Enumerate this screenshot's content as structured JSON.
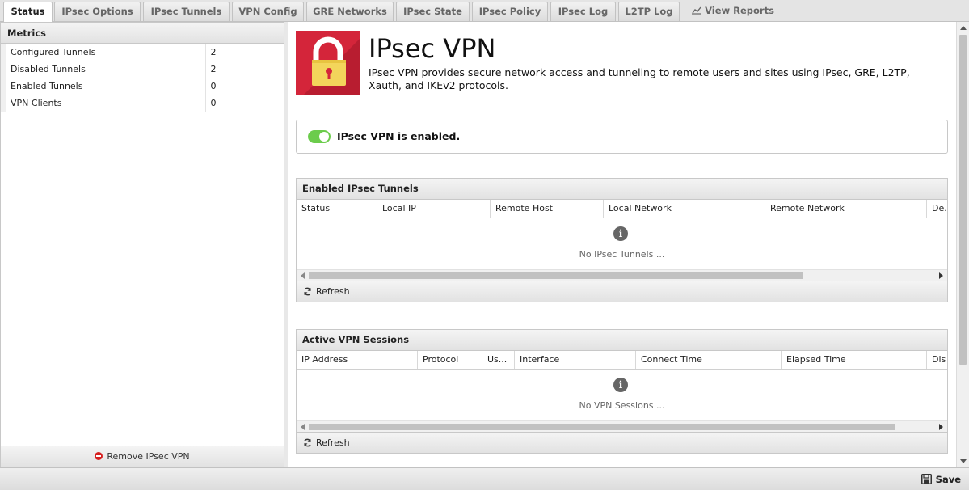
{
  "tabs": [
    {
      "label": "Status",
      "active": true
    },
    {
      "label": "IPsec Options"
    },
    {
      "label": "IPsec Tunnels"
    },
    {
      "label": "VPN Config"
    },
    {
      "label": "GRE Networks"
    },
    {
      "label": "IPsec State"
    },
    {
      "label": "IPsec Policy"
    },
    {
      "label": "IPsec Log"
    },
    {
      "label": "L2TP Log"
    },
    {
      "label": "View Reports",
      "icon": "chart-icon"
    }
  ],
  "metrics": {
    "title": "Metrics",
    "rows": [
      {
        "name": "Configured Tunnels",
        "value": "2"
      },
      {
        "name": "Disabled Tunnels",
        "value": "2"
      },
      {
        "name": "Enabled Tunnels",
        "value": "0"
      },
      {
        "name": "VPN Clients",
        "value": "0"
      }
    ],
    "remove_label": "Remove IPsec VPN"
  },
  "app": {
    "title": "IPsec VPN",
    "description": "IPsec VPN provides secure network access and tunneling to remote users and sites using IPsec, GRE, L2TP, Xauth, and IKEv2 protocols.",
    "logo_icon": "padlock-icon",
    "logo_color": "#d4253a",
    "status_text": "IPsec VPN is enabled.",
    "enabled": true,
    "toggle_color": "#6ccc4c"
  },
  "tunnels_grid": {
    "title": "Enabled IPsec Tunnels",
    "columns": [
      "Status",
      "Local IP",
      "Remote Host",
      "Local Network",
      "Remote Network",
      "De..."
    ],
    "empty_text": "No IPsec Tunnels ...",
    "refresh_label": "Refresh"
  },
  "sessions_grid": {
    "title": "Active VPN Sessions",
    "columns": [
      "IP Address",
      "Protocol",
      "Us...",
      "Interface",
      "Connect Time",
      "Elapsed Time",
      "Dis"
    ],
    "empty_text": "No VPN Sessions ...",
    "refresh_label": "Refresh"
  },
  "footer": {
    "save_label": "Save"
  }
}
